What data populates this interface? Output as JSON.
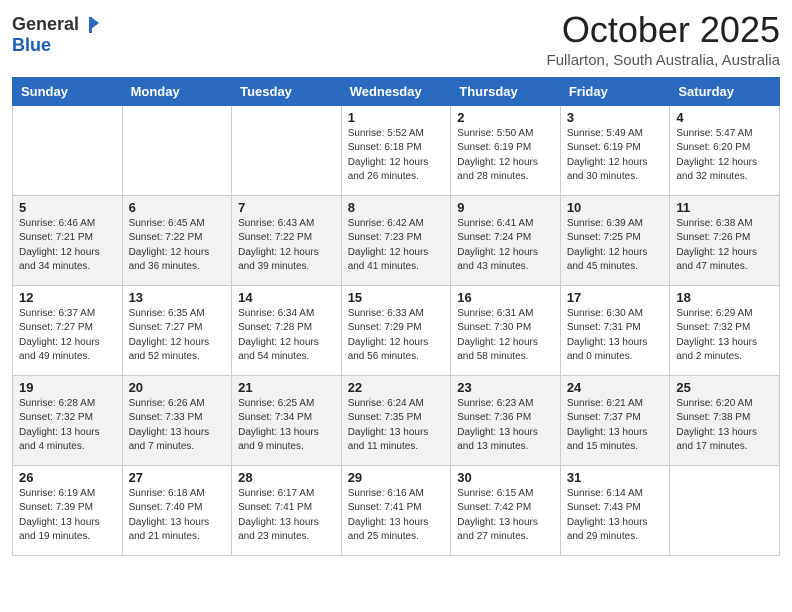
{
  "logo": {
    "general": "General",
    "blue": "Blue"
  },
  "header": {
    "month": "October 2025",
    "location": "Fullarton, South Australia, Australia"
  },
  "days_of_week": [
    "Sunday",
    "Monday",
    "Tuesday",
    "Wednesday",
    "Thursday",
    "Friday",
    "Saturday"
  ],
  "weeks": [
    [
      {
        "day": "",
        "info": ""
      },
      {
        "day": "",
        "info": ""
      },
      {
        "day": "",
        "info": ""
      },
      {
        "day": "1",
        "info": "Sunrise: 5:52 AM\nSunset: 6:18 PM\nDaylight: 12 hours\nand 26 minutes."
      },
      {
        "day": "2",
        "info": "Sunrise: 5:50 AM\nSunset: 6:19 PM\nDaylight: 12 hours\nand 28 minutes."
      },
      {
        "day": "3",
        "info": "Sunrise: 5:49 AM\nSunset: 6:19 PM\nDaylight: 12 hours\nand 30 minutes."
      },
      {
        "day": "4",
        "info": "Sunrise: 5:47 AM\nSunset: 6:20 PM\nDaylight: 12 hours\nand 32 minutes."
      }
    ],
    [
      {
        "day": "5",
        "info": "Sunrise: 6:46 AM\nSunset: 7:21 PM\nDaylight: 12 hours\nand 34 minutes."
      },
      {
        "day": "6",
        "info": "Sunrise: 6:45 AM\nSunset: 7:22 PM\nDaylight: 12 hours\nand 36 minutes."
      },
      {
        "day": "7",
        "info": "Sunrise: 6:43 AM\nSunset: 7:22 PM\nDaylight: 12 hours\nand 39 minutes."
      },
      {
        "day": "8",
        "info": "Sunrise: 6:42 AM\nSunset: 7:23 PM\nDaylight: 12 hours\nand 41 minutes."
      },
      {
        "day": "9",
        "info": "Sunrise: 6:41 AM\nSunset: 7:24 PM\nDaylight: 12 hours\nand 43 minutes."
      },
      {
        "day": "10",
        "info": "Sunrise: 6:39 AM\nSunset: 7:25 PM\nDaylight: 12 hours\nand 45 minutes."
      },
      {
        "day": "11",
        "info": "Sunrise: 6:38 AM\nSunset: 7:26 PM\nDaylight: 12 hours\nand 47 minutes."
      }
    ],
    [
      {
        "day": "12",
        "info": "Sunrise: 6:37 AM\nSunset: 7:27 PM\nDaylight: 12 hours\nand 49 minutes."
      },
      {
        "day": "13",
        "info": "Sunrise: 6:35 AM\nSunset: 7:27 PM\nDaylight: 12 hours\nand 52 minutes."
      },
      {
        "day": "14",
        "info": "Sunrise: 6:34 AM\nSunset: 7:28 PM\nDaylight: 12 hours\nand 54 minutes."
      },
      {
        "day": "15",
        "info": "Sunrise: 6:33 AM\nSunset: 7:29 PM\nDaylight: 12 hours\nand 56 minutes."
      },
      {
        "day": "16",
        "info": "Sunrise: 6:31 AM\nSunset: 7:30 PM\nDaylight: 12 hours\nand 58 minutes."
      },
      {
        "day": "17",
        "info": "Sunrise: 6:30 AM\nSunset: 7:31 PM\nDaylight: 13 hours\nand 0 minutes."
      },
      {
        "day": "18",
        "info": "Sunrise: 6:29 AM\nSunset: 7:32 PM\nDaylight: 13 hours\nand 2 minutes."
      }
    ],
    [
      {
        "day": "19",
        "info": "Sunrise: 6:28 AM\nSunset: 7:32 PM\nDaylight: 13 hours\nand 4 minutes."
      },
      {
        "day": "20",
        "info": "Sunrise: 6:26 AM\nSunset: 7:33 PM\nDaylight: 13 hours\nand 7 minutes."
      },
      {
        "day": "21",
        "info": "Sunrise: 6:25 AM\nSunset: 7:34 PM\nDaylight: 13 hours\nand 9 minutes."
      },
      {
        "day": "22",
        "info": "Sunrise: 6:24 AM\nSunset: 7:35 PM\nDaylight: 13 hours\nand 11 minutes."
      },
      {
        "day": "23",
        "info": "Sunrise: 6:23 AM\nSunset: 7:36 PM\nDaylight: 13 hours\nand 13 minutes."
      },
      {
        "day": "24",
        "info": "Sunrise: 6:21 AM\nSunset: 7:37 PM\nDaylight: 13 hours\nand 15 minutes."
      },
      {
        "day": "25",
        "info": "Sunrise: 6:20 AM\nSunset: 7:38 PM\nDaylight: 13 hours\nand 17 minutes."
      }
    ],
    [
      {
        "day": "26",
        "info": "Sunrise: 6:19 AM\nSunset: 7:39 PM\nDaylight: 13 hours\nand 19 minutes."
      },
      {
        "day": "27",
        "info": "Sunrise: 6:18 AM\nSunset: 7:40 PM\nDaylight: 13 hours\nand 21 minutes."
      },
      {
        "day": "28",
        "info": "Sunrise: 6:17 AM\nSunset: 7:41 PM\nDaylight: 13 hours\nand 23 minutes."
      },
      {
        "day": "29",
        "info": "Sunrise: 6:16 AM\nSunset: 7:41 PM\nDaylight: 13 hours\nand 25 minutes."
      },
      {
        "day": "30",
        "info": "Sunrise: 6:15 AM\nSunset: 7:42 PM\nDaylight: 13 hours\nand 27 minutes."
      },
      {
        "day": "31",
        "info": "Sunrise: 6:14 AM\nSunset: 7:43 PM\nDaylight: 13 hours\nand 29 minutes."
      },
      {
        "day": "",
        "info": ""
      }
    ]
  ]
}
